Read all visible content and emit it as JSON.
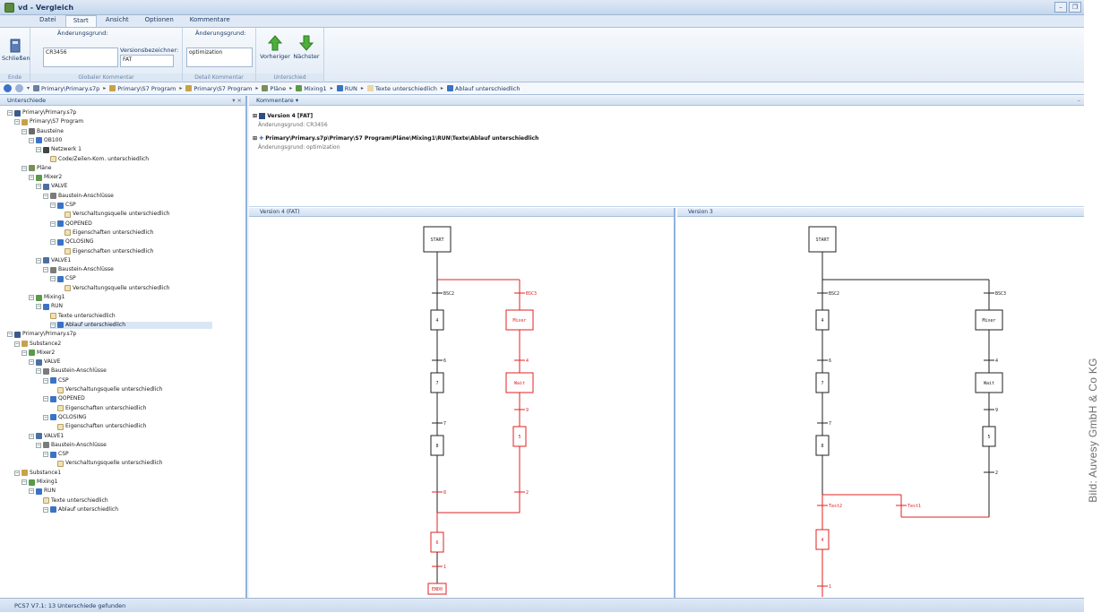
{
  "window": {
    "title": "vd - Vergleich"
  },
  "menu": {
    "tabs": [
      "Datei",
      "Start",
      "Ansicht",
      "Optionen",
      "Kommentare"
    ],
    "active": "Start"
  },
  "ribbon": {
    "close_label": "Schließen",
    "group_ende": "Ende",
    "change_reason_label": "Änderungsgrund:",
    "change_reason_value": "CR3456",
    "version_label": "Versionsbezeichner:",
    "version_value": "FAT",
    "group_global": "Globaler Kommentar",
    "detail_reason_label": "Änderungsgrund:",
    "detail_reason_value": "optimization",
    "group_detail": "Detail Kommentar",
    "prev_label": "Vorheriger",
    "next_label": "Nächster",
    "group_diff": "Unterschied"
  },
  "breadcrumb": [
    "Primary\\Primary.s7p",
    "Primary\\S7 Program",
    "Primary\\S7 Program",
    "Pläne",
    "Mixing1",
    "RUN",
    "Texte unterschiedlich",
    "Ablauf unterschiedlich"
  ],
  "left_panel": {
    "title": "Unterschiede",
    "tree": [
      {
        "label": "Primary\\Primary.s7p",
        "level": 0,
        "icon": "project-icon"
      },
      {
        "label": "Primary\\S7 Program",
        "level": 1,
        "icon": "program-icon"
      },
      {
        "label": "Bausteine",
        "level": 2,
        "icon": "blocks-icon"
      },
      {
        "label": "OB100",
        "level": 3,
        "icon": "block-icon"
      },
      {
        "label": "Netzwerk 1",
        "level": 4,
        "icon": "network-icon"
      },
      {
        "label": "Code/Zeilen-Kom. unterschiedlich",
        "level": 5,
        "icon": "diff-icon"
      },
      {
        "label": "Pläne",
        "level": 2,
        "icon": "plans-icon"
      },
      {
        "label": "Mixer2",
        "level": 3,
        "icon": "chart-icon"
      },
      {
        "label": "VALVE",
        "level": 4,
        "icon": "valve-icon"
      },
      {
        "label": "Baustein-Anschlüsse",
        "level": 5,
        "icon": "connector-icon"
      },
      {
        "label": "CSP",
        "level": 6,
        "icon": "pin-icon"
      },
      {
        "label": "Verschaltungsquelle unterschiedlich",
        "level": 7,
        "icon": "diff-icon"
      },
      {
        "label": "QOPENED",
        "level": 6,
        "icon": "pin-icon"
      },
      {
        "label": "Eigenschaften unterschiedlich",
        "level": 7,
        "icon": "diff-icon"
      },
      {
        "label": "QCLOSING",
        "level": 6,
        "icon": "pin-icon"
      },
      {
        "label": "Eigenschaften unterschiedlich",
        "level": 7,
        "icon": "diff-icon"
      },
      {
        "label": "VALVE1",
        "level": 4,
        "icon": "valve-icon"
      },
      {
        "label": "Baustein-Anschlüsse",
        "level": 5,
        "icon": "connector-icon"
      },
      {
        "label": "CSP",
        "level": 6,
        "icon": "pin-icon"
      },
      {
        "label": "Verschaltungsquelle unterschiedlich",
        "level": 7,
        "icon": "diff-icon"
      },
      {
        "label": "Mixing1",
        "level": 3,
        "icon": "chart-icon"
      },
      {
        "label": "RUN",
        "level": 4,
        "icon": "sequence-icon"
      },
      {
        "label": "Texte unterschiedlich",
        "level": 5,
        "icon": "diff-icon"
      },
      {
        "label": "Ablauf unterschiedlich",
        "level": 6,
        "icon": "sequence-icon",
        "selected": true
      },
      {
        "label": "Primary\\Primary.s7p",
        "level": 0,
        "icon": "project-icon"
      },
      {
        "label": "Substance2",
        "level": 1,
        "icon": "folder-icon"
      },
      {
        "label": "Mixer2",
        "level": 2,
        "icon": "chart-icon"
      },
      {
        "label": "VALVE",
        "level": 3,
        "icon": "valve-icon"
      },
      {
        "label": "Baustein-Anschlüsse",
        "level": 4,
        "icon": "connector-icon"
      },
      {
        "label": "CSP",
        "level": 5,
        "icon": "pin-icon"
      },
      {
        "label": "Verschaltungsquelle unterschiedlich",
        "level": 6,
        "icon": "diff-icon"
      },
      {
        "label": "QOPENED",
        "level": 5,
        "icon": "pin-icon"
      },
      {
        "label": "Eigenschaften unterschiedlich",
        "level": 6,
        "icon": "diff-icon"
      },
      {
        "label": "QCLOSING",
        "level": 5,
        "icon": "pin-icon"
      },
      {
        "label": "Eigenschaften unterschiedlich",
        "level": 6,
        "icon": "diff-icon"
      },
      {
        "label": "VALVE1",
        "level": 3,
        "icon": "valve-icon"
      },
      {
        "label": "Baustein-Anschlüsse",
        "level": 4,
        "icon": "connector-icon"
      },
      {
        "label": "CSP",
        "level": 5,
        "icon": "pin-icon"
      },
      {
        "label": "Verschaltungsquelle unterschiedlich",
        "level": 6,
        "icon": "diff-icon"
      },
      {
        "label": "Substance1",
        "level": 1,
        "icon": "folder-icon"
      },
      {
        "label": "Mixing1",
        "level": 2,
        "icon": "chart-icon"
      },
      {
        "label": "RUN",
        "level": 3,
        "icon": "sequence-icon"
      },
      {
        "label": "Texte unterschiedlich",
        "level": 4,
        "icon": "diff-icon"
      },
      {
        "label": "Ablauf unterschiedlich",
        "level": 5,
        "icon": "sequence-icon"
      }
    ]
  },
  "comments": {
    "title": "Kommentare",
    "version_header": "Version 4 [FAT]",
    "reason1_label": "Änderungsgrund:",
    "reason1_value": "CR3456",
    "path": "Primary\\Primary.s7p\\Primary\\S7 Program\\Pläne\\Mixing1\\RUN\\Texte\\Ablauf unterschiedlich",
    "reason2_label": "Änderungsgrund:",
    "reason2_value": "optimization"
  },
  "diagram_left": {
    "title": "Version 4 (FAT)",
    "start": "START",
    "trans_left": "BSC2",
    "trans_right": "BSC3",
    "steps": [
      "4",
      "6",
      "7",
      "7",
      "8",
      "8",
      "Mixer",
      "4",
      "Wait",
      "9",
      "5",
      "2",
      "6",
      "1",
      "END0"
    ]
  },
  "diagram_right": {
    "title": "Version 3",
    "start": "START",
    "trans_left": "BSC2",
    "trans_right": "BSC3",
    "steps": [
      "4",
      "6",
      "7",
      "7",
      "8",
      "8",
      "Mixer",
      "4",
      "Wait",
      "9",
      "5",
      "2",
      "Test2",
      "Test1",
      "4",
      "1"
    ]
  },
  "status": {
    "text": "PCS7 V7.1: 13 Unterschiede gefunden"
  },
  "caption": "Bild: Auvesy GmbH & Co KG",
  "colors": {
    "diff": "#e02020",
    "normal": "#222222",
    "accent": "#3b73c4"
  }
}
